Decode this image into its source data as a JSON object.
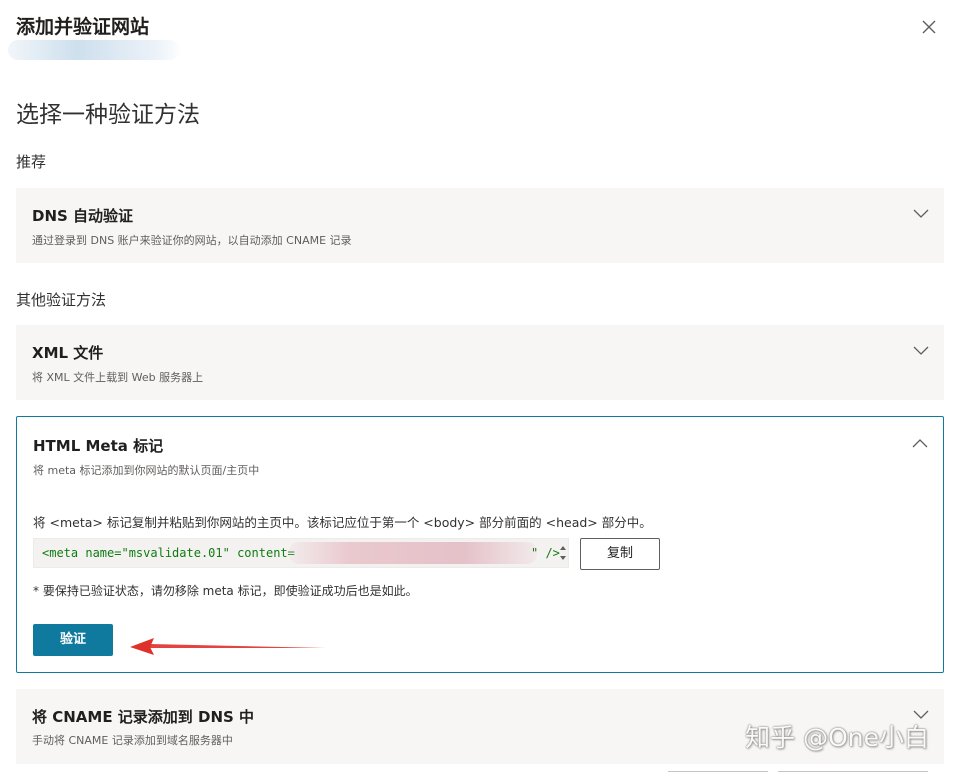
{
  "dialog": {
    "title": "添加并验证网站",
    "close_icon": "close-icon"
  },
  "heading": "选择一种验证方法",
  "sections": {
    "recommended_label": "推荐",
    "other_label": "其他验证方法"
  },
  "methods": [
    {
      "title": "DNS 自动验证",
      "subtitle": "通过登录到 DNS 账户来验证你的网站，以自动添加 CNAME 记录",
      "expanded": false
    },
    {
      "title": "XML 文件",
      "subtitle": "将 XML 文件上载到 Web 服务器上",
      "expanded": false
    },
    {
      "title": "HTML Meta 标记",
      "subtitle": "将 meta 标记添加到你网站的默认页面/主页中",
      "expanded": true,
      "instructions": "将 <meta> 标记复制并粘贴到你网站的主页中。该标记应位于第一个 <body> 部分前面的 <head> 部分中。",
      "meta_tag_visible": "<meta name=\"msvalidate.01\" content=",
      "meta_tag_tail": "\" />",
      "copy_label": "复制",
      "note": "* 要保持已验证状态，请勿移除 meta 标记，即使验证成功后也是如此。",
      "verify_label": "验证"
    },
    {
      "title": "将 CNAME 记录添加到 DNS 中",
      "subtitle": "手动将 CNAME 记录添加到域名服务器中",
      "expanded": false
    }
  ],
  "watermark": "知乎 @One小白",
  "colors": {
    "accent": "#0f7a9e",
    "card_bg": "#f7f6f5",
    "annotation_arrow": "#e0302a",
    "code_text": "#107c10"
  }
}
